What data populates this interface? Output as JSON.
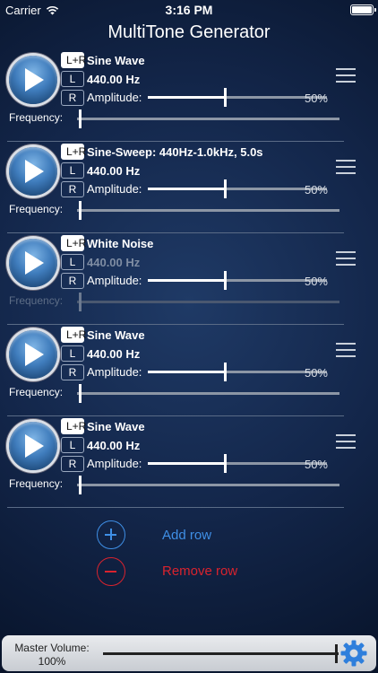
{
  "status": {
    "carrier": "Carrier",
    "time": "3:16 PM"
  },
  "app_title": "MultiTone Generator",
  "rows": [
    {
      "channel_lr": "L+R",
      "channel_l": "L",
      "channel_r": "R",
      "wave_name": "Sine Wave",
      "frequency": "440.00 Hz",
      "amplitude_label": "Amplitude:",
      "amplitude_text": "50%",
      "amplitude_value": 0.5,
      "frequency_label": "Frequency:",
      "frequency_slider_value": 0.0,
      "disabled": false
    },
    {
      "channel_lr": "L+R",
      "channel_l": "L",
      "channel_r": "R",
      "wave_name": "Sine-Sweep: 440Hz-1.0kHz, 5.0s",
      "frequency": "440.00 Hz",
      "amplitude_label": "Amplitude:",
      "amplitude_text": "50%",
      "amplitude_value": 0.5,
      "frequency_label": "Frequency:",
      "frequency_slider_value": 0.0,
      "disabled": false
    },
    {
      "channel_lr": "L+R",
      "channel_l": "L",
      "channel_r": "R",
      "wave_name": "White Noise",
      "frequency": "440.00 Hz",
      "amplitude_label": "Amplitude:",
      "amplitude_text": "50%",
      "amplitude_value": 0.5,
      "frequency_label": "Frequency:",
      "frequency_slider_value": 0.0,
      "disabled": true
    },
    {
      "channel_lr": "L+R",
      "channel_l": "L",
      "channel_r": "R",
      "wave_name": "Sine Wave",
      "frequency": "440.00 Hz",
      "amplitude_label": "Amplitude:",
      "amplitude_text": "50%",
      "amplitude_value": 0.5,
      "frequency_label": "Frequency:",
      "frequency_slider_value": 0.0,
      "disabled": false
    },
    {
      "channel_lr": "L+R",
      "channel_l": "L",
      "channel_r": "R",
      "wave_name": "Sine Wave",
      "frequency": "440.00 Hz",
      "amplitude_label": "Amplitude:",
      "amplitude_text": "50%",
      "amplitude_value": 0.5,
      "frequency_label": "Frequency:",
      "frequency_slider_value": 0.0,
      "disabled": false
    }
  ],
  "actions": {
    "add_label": "Add row",
    "remove_label": "Remove row"
  },
  "master": {
    "label": "Master Volume:",
    "value_text": "100%",
    "value": 1.0
  },
  "colors": {
    "add": "#3f8fe6",
    "remove": "#d9232e",
    "background": "#13264a"
  },
  "icons": {
    "play": "play-icon",
    "menu": "hamburger-menu-icon",
    "settings": "gear-icon",
    "add": "plus-circle-icon",
    "remove": "minus-circle-icon",
    "wifi": "wifi-icon",
    "battery": "battery-icon"
  }
}
